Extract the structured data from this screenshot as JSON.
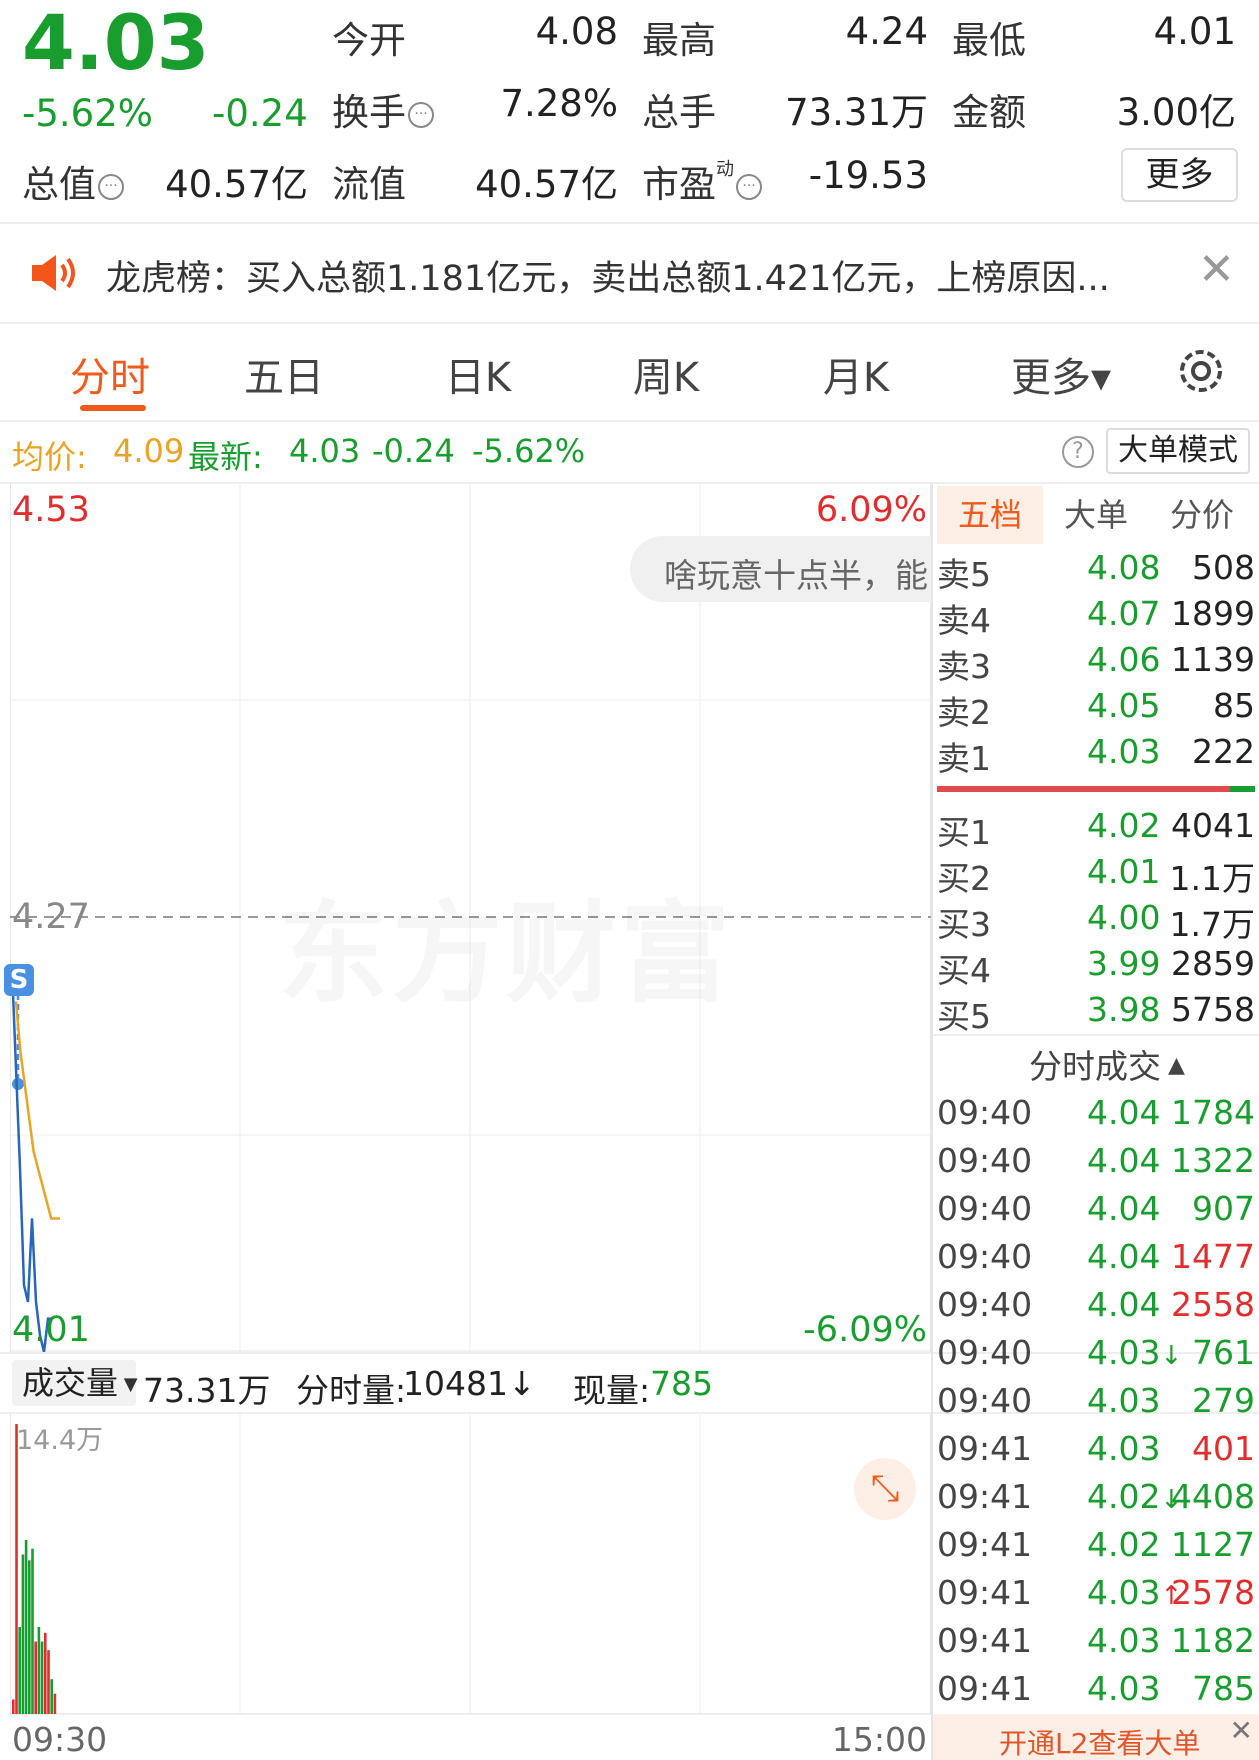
{
  "quote": {
    "price": "4.03",
    "change_pct": "-5.62%",
    "change": "-0.24",
    "stats": [
      {
        "label": "今开",
        "value": "4.08",
        "color": "green"
      },
      {
        "label": "最高",
        "value": "4.24",
        "color": "green"
      },
      {
        "label": "最低",
        "value": "4.01",
        "color": "green"
      },
      {
        "label": "换手",
        "value": "7.28%",
        "color": "dark"
      },
      {
        "label": "总手",
        "value": "73.31万",
        "color": "dark"
      },
      {
        "label": "金额",
        "value": "3.00亿",
        "color": "dark"
      },
      {
        "label": "总值",
        "value": "40.57亿",
        "color": "dark"
      },
      {
        "label": "流值",
        "value": "40.57亿",
        "color": "dark"
      },
      {
        "label": "市盈",
        "value": "-19.53",
        "color": "dark"
      }
    ],
    "pe_superscript": "动",
    "more_button": "更多"
  },
  "notice": {
    "text": "龙虎榜：买入总额1.181亿元，卖出总额1.421亿元，上榜原因..."
  },
  "tabs": [
    {
      "label": "分时",
      "active": true
    },
    {
      "label": "五日",
      "active": false
    },
    {
      "label": "日K",
      "active": false
    },
    {
      "label": "周K",
      "active": false
    },
    {
      "label": "月K",
      "active": false
    },
    {
      "label": "更多▾",
      "active": false
    }
  ],
  "info_bar": {
    "avg_label": "均价:",
    "avg_value": "4.09",
    "latest_label": "最新:",
    "latest_value": "4.03",
    "latest_change": "-0.24",
    "latest_pct": "-5.62%",
    "help_icon_text": "?",
    "big_order_button": "大单模式"
  },
  "chart": {
    "y_top": "4.53",
    "y_mid": "4.27",
    "y_bottom": "4.01",
    "pct_top": "6.09%",
    "pct_bottom": "-6.09%",
    "watermark": "东方财富",
    "comment_bubble": "啥玩意十点半，能",
    "marker_label": "S",
    "price_series": [
      4.24,
      4.18,
      4.12,
      4.05,
      4.04,
      4.09,
      4.04,
      4.02,
      4.01,
      4.03,
      4.03
    ],
    "avg_series": [
      4.22,
      4.19,
      4.17,
      4.15,
      4.13,
      4.12,
      4.11,
      4.1,
      4.09,
      4.09,
      4.09
    ]
  },
  "volume_bar": {
    "label": "成交量",
    "total": "73.31万",
    "minute_vol_label": "分时量:",
    "minute_vol": "10481",
    "minute_vol_arrow": "↓",
    "cur_vol_label": "现量:",
    "cur_vol": "785",
    "max_label": "14.4万",
    "time_start": "09:30",
    "time_end": "15:00",
    "bars": [
      {
        "v": 0.05,
        "c": "red"
      },
      {
        "v": 1.0,
        "c": "red"
      },
      {
        "v": 0.3,
        "c": "green"
      },
      {
        "v": 0.55,
        "c": "green"
      },
      {
        "v": 0.6,
        "c": "green"
      },
      {
        "v": 0.53,
        "c": "green"
      },
      {
        "v": 0.57,
        "c": "green"
      },
      {
        "v": 0.25,
        "c": "red"
      },
      {
        "v": 0.3,
        "c": "green"
      },
      {
        "v": 0.25,
        "c": "green"
      },
      {
        "v": 0.28,
        "c": "red"
      },
      {
        "v": 0.22,
        "c": "red"
      },
      {
        "v": 0.12,
        "c": "green"
      },
      {
        "v": 0.07,
        "c": "red"
      }
    ]
  },
  "orderbook": {
    "tabs": [
      "五档",
      "大单",
      "分价"
    ],
    "asks": [
      {
        "label": "卖5",
        "price": "4.08",
        "qty": "508"
      },
      {
        "label": "卖4",
        "price": "4.07",
        "qty": "1899"
      },
      {
        "label": "卖3",
        "price": "4.06",
        "qty": "1139"
      },
      {
        "label": "卖2",
        "price": "4.05",
        "qty": "85"
      },
      {
        "label": "卖1",
        "price": "4.03",
        "qty": "222"
      }
    ],
    "bids": [
      {
        "label": "买1",
        "price": "4.02",
        "qty": "4041"
      },
      {
        "label": "买2",
        "price": "4.01",
        "qty": "1.1万"
      },
      {
        "label": "买3",
        "price": "4.00",
        "qty": "1.7万"
      },
      {
        "label": "买4",
        "price": "3.99",
        "qty": "2859"
      },
      {
        "label": "买5",
        "price": "3.98",
        "qty": "5758"
      }
    ],
    "bid_ratio": 0.92
  },
  "trades": {
    "title": "分时成交",
    "rows": [
      {
        "time": "09:40",
        "price": "4.04",
        "arrow": "",
        "qty": "1784",
        "color": "green"
      },
      {
        "time": "09:40",
        "price": "4.04",
        "arrow": "",
        "qty": "1322",
        "color": "green"
      },
      {
        "time": "09:40",
        "price": "4.04",
        "arrow": "",
        "qty": "907",
        "color": "green"
      },
      {
        "time": "09:40",
        "price": "4.04",
        "arrow": "",
        "qty": "1477",
        "color": "red"
      },
      {
        "time": "09:40",
        "price": "4.04",
        "arrow": "",
        "qty": "2558",
        "color": "red"
      },
      {
        "time": "09:40",
        "price": "4.03",
        "arrow": "↓",
        "qty": "761",
        "color": "green"
      },
      {
        "time": "09:40",
        "price": "4.03",
        "arrow": "",
        "qty": "279",
        "color": "green"
      },
      {
        "time": "09:41",
        "price": "4.03",
        "arrow": "",
        "qty": "401",
        "color": "red"
      },
      {
        "time": "09:41",
        "price": "4.02",
        "arrow": "↓",
        "qty": "4408",
        "color": "green"
      },
      {
        "time": "09:41",
        "price": "4.02",
        "arrow": "",
        "qty": "1127",
        "color": "green"
      },
      {
        "time": "09:41",
        "price": "4.03",
        "arrow": "↑",
        "qty": "2578",
        "color": "red"
      },
      {
        "time": "09:41",
        "price": "4.03",
        "arrow": "",
        "qty": "1182",
        "color": "green"
      },
      {
        "time": "09:41",
        "price": "4.03",
        "arrow": "",
        "qty": "785",
        "color": "green"
      }
    ],
    "l2_banner": "开通L2查看大单"
  }
}
